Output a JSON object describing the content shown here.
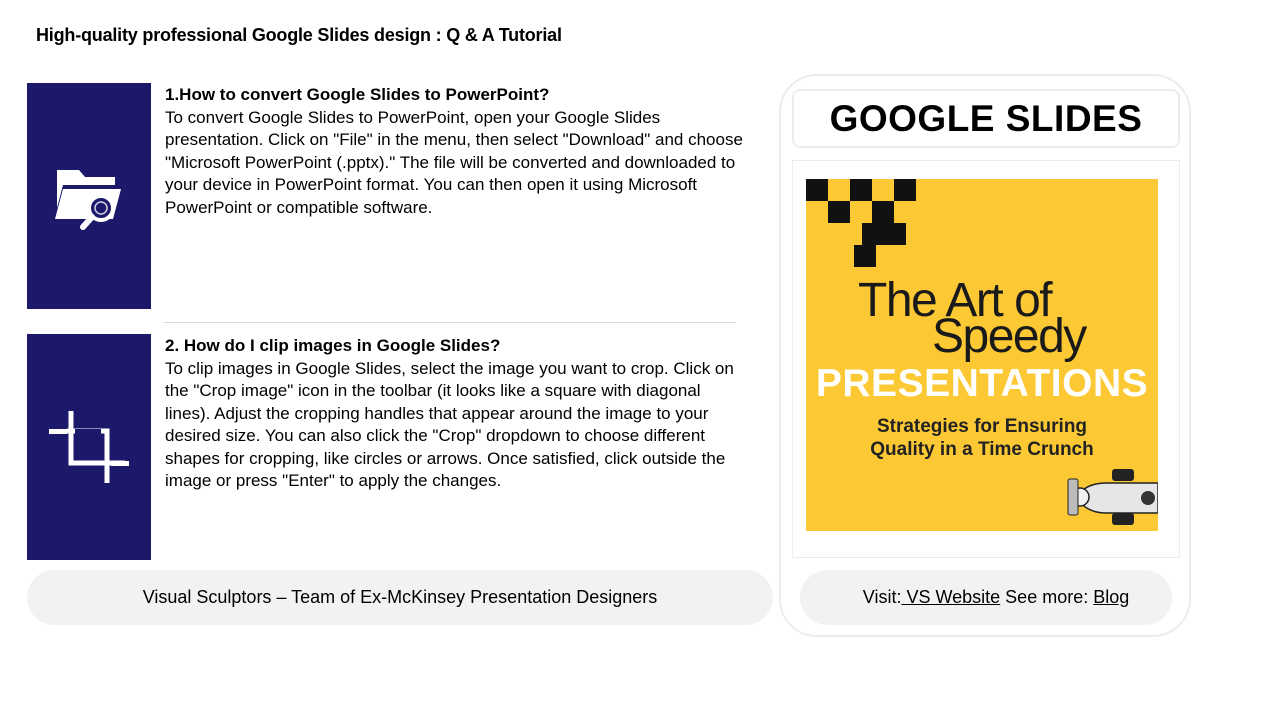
{
  "page": {
    "title": "High-quality professional Google Slides design : Q & A Tutorial"
  },
  "qa": [
    {
      "question": "1.How to convert Google Slides to PowerPoint?",
      "answer": "To convert Google Slides to PowerPoint, open your Google Slides presentation. Click on \"File\" in the menu, then select \"Download\" and choose \"Microsoft PowerPoint (.pptx).\" The file will be converted and downloaded to your device in PowerPoint format. You can then open it using Microsoft PowerPoint or compatible software.",
      "icon": "folder-search-icon"
    },
    {
      "question": "2. How do I clip images in Google Slides?",
      "answer": "To clip images in Google Slides, select the image you want to crop. Click on the \"Crop image\" icon in the toolbar (it looks like a square with diagonal lines). Adjust the cropping handles that appear around the image to your desired size. You can also click the \"Crop\" dropdown to choose different shapes for cropping, like circles or arrows. Once satisfied, click outside the image or press \"Enter\" to apply the changes.",
      "icon": "crop-icon"
    }
  ],
  "footer": {
    "team_text": "Visual Sculptors – Team of Ex-McKinsey Presentation Designers",
    "visit_label": "Visit:",
    "website_link": " VS Website",
    "see_more_label": " See more: ",
    "blog_link": "Blog"
  },
  "side_panel": {
    "title": "GOOGLE SLIDES",
    "cover": {
      "line1": "The Art of",
      "line2": "Speedy",
      "line3": "PRESENTATIONS",
      "line4": "Strategies for Ensuring",
      "line5": "Quality in a Time Crunch",
      "background_color": "#fcc934"
    }
  },
  "colors": {
    "icon_box": "#1c196b",
    "pill_bg": "#f2f2f2"
  }
}
